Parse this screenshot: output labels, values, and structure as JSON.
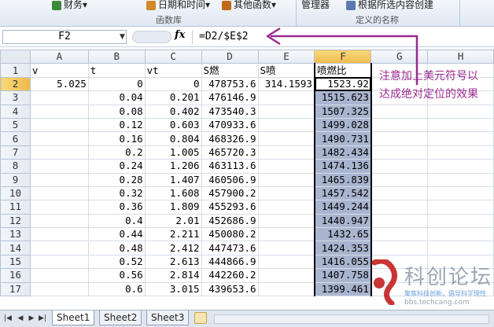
{
  "ribbon": {
    "items": [
      {
        "label": "财务▾",
        "color": "#3a8a3a"
      },
      {
        "label": "日期和时间▾",
        "color": "#d08a2a"
      },
      {
        "label": "其他函数▾",
        "color": "#c06a1a"
      },
      {
        "label": "管理器",
        "color": "#5a7ab0"
      },
      {
        "label": "根据所选内容创建",
        "color": "#5a7ab0"
      }
    ],
    "group_function_library": "函数库",
    "group_defined_names": "定义的名称"
  },
  "formula_bar": {
    "name_box": "F2",
    "fx_label": "fx",
    "formula": "=D2/$E$2"
  },
  "grid": {
    "columns": [
      "A",
      "B",
      "C",
      "D",
      "E",
      "F",
      "G",
      "H"
    ],
    "active_column": "F",
    "active_row": "2",
    "rows": [
      {
        "n": "1",
        "cells": [
          "v",
          "t",
          "vt",
          "S燃",
          "S喷",
          "喷燃比",
          "",
          ""
        ]
      },
      {
        "n": "2",
        "cells": [
          "5.025",
          "0",
          "0",
          "478753.6",
          "314.1593",
          "1523.92",
          "",
          ""
        ]
      },
      {
        "n": "3",
        "cells": [
          "",
          "0.04",
          "0.201",
          "476146.9",
          "",
          "1515.623",
          "",
          ""
        ]
      },
      {
        "n": "4",
        "cells": [
          "",
          "0.08",
          "0.402",
          "473540.3",
          "",
          "1507.325",
          "",
          ""
        ]
      },
      {
        "n": "5",
        "cells": [
          "",
          "0.12",
          "0.603",
          "470933.6",
          "",
          "1499.028",
          "",
          ""
        ]
      },
      {
        "n": "6",
        "cells": [
          "",
          "0.16",
          "0.804",
          "468326.9",
          "",
          "1490.731",
          "",
          ""
        ]
      },
      {
        "n": "7",
        "cells": [
          "",
          "0.2",
          "1.005",
          "465720.3",
          "",
          "1482.434",
          "",
          ""
        ]
      },
      {
        "n": "8",
        "cells": [
          "",
          "0.24",
          "1.206",
          "463113.6",
          "",
          "1474.136",
          "",
          ""
        ]
      },
      {
        "n": "9",
        "cells": [
          "",
          "0.28",
          "1.407",
          "460506.9",
          "",
          "1465.839",
          "",
          ""
        ]
      },
      {
        "n": "10",
        "cells": [
          "",
          "0.32",
          "1.608",
          "457900.2",
          "",
          "1457.542",
          "",
          ""
        ]
      },
      {
        "n": "11",
        "cells": [
          "",
          "0.36",
          "1.809",
          "455293.6",
          "",
          "1449.244",
          "",
          ""
        ]
      },
      {
        "n": "12",
        "cells": [
          "",
          "0.4",
          "2.01",
          "452686.9",
          "",
          "1440.947",
          "",
          ""
        ]
      },
      {
        "n": "13",
        "cells": [
          "",
          "0.44",
          "2.211",
          "450080.2",
          "",
          "1432.65",
          "",
          ""
        ]
      },
      {
        "n": "14",
        "cells": [
          "",
          "0.48",
          "2.412",
          "447473.6",
          "",
          "1424.353",
          "",
          ""
        ]
      },
      {
        "n": "15",
        "cells": [
          "",
          "0.52",
          "2.613",
          "444866.9",
          "",
          "1416.055",
          "",
          ""
        ]
      },
      {
        "n": "16",
        "cells": [
          "",
          "0.56",
          "2.814",
          "442260.2",
          "",
          "1407.758",
          "",
          ""
        ]
      },
      {
        "n": "17",
        "cells": [
          "",
          "0.6",
          "3.015",
          "439653.6",
          "",
          "1399.461",
          "",
          ""
        ]
      }
    ]
  },
  "sheet_tabs": [
    "Sheet1",
    "Sheet2",
    "Sheet3"
  ],
  "active_sheet": "Sheet1",
  "annotation": {
    "text": "注意加上美元符号以\n达成绝对定位的效果",
    "color": "#9b2a8f"
  },
  "watermark": {
    "title": "科创论坛",
    "subtitle": "聚焦科技创新，倡导科学理性",
    "url": "bbs.techcang.com"
  }
}
